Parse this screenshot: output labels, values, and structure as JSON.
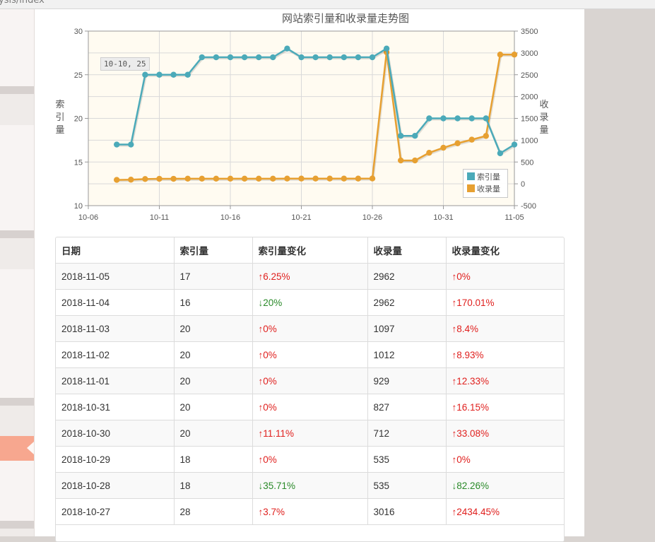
{
  "browser": {
    "url_fragment": "ysis/index"
  },
  "chart_data": {
    "type": "line",
    "title": "网站索引量和收录量走势图",
    "x_tick_labels": [
      "10-06",
      "10-11",
      "10-16",
      "10-21",
      "10-26",
      "10-31",
      "11-05"
    ],
    "x_range": [
      "2018-10-06",
      "2018-11-05"
    ],
    "left_axis": {
      "label": "索引量",
      "range": [
        10,
        30
      ],
      "ticks": [
        10,
        15,
        20,
        25,
        30
      ]
    },
    "right_axis": {
      "label": "收录量",
      "range": [
        -500,
        3500
      ],
      "ticks": [
        -500,
        0,
        500,
        1000,
        1500,
        2000,
        2500,
        3000,
        3500
      ]
    },
    "grid": true,
    "legend_position": "bottom-right",
    "tooltip": "10-10, 25",
    "series": [
      {
        "name": "索引量",
        "axis": "left",
        "color": "#4baab9",
        "x": [
          "2018-10-08",
          "2018-10-09",
          "2018-10-10",
          "2018-10-11",
          "2018-10-12",
          "2018-10-13",
          "2018-10-14",
          "2018-10-15",
          "2018-10-16",
          "2018-10-17",
          "2018-10-18",
          "2018-10-19",
          "2018-10-20",
          "2018-10-21",
          "2018-10-22",
          "2018-10-23",
          "2018-10-24",
          "2018-10-25",
          "2018-10-26",
          "2018-10-27",
          "2018-10-28",
          "2018-10-29",
          "2018-10-30",
          "2018-10-31",
          "2018-11-01",
          "2018-11-02",
          "2018-11-03",
          "2018-11-04",
          "2018-11-05"
        ],
        "values": [
          17,
          17,
          25,
          25,
          25,
          25,
          27,
          27,
          27,
          27,
          27,
          27,
          28,
          27,
          27,
          27,
          27,
          27,
          27,
          28,
          18,
          18,
          20,
          20,
          20,
          20,
          20,
          16,
          17
        ]
      },
      {
        "name": "收录量",
        "axis": "right",
        "color": "#e7a031",
        "x": [
          "2018-10-08",
          "2018-10-09",
          "2018-10-10",
          "2018-10-11",
          "2018-10-12",
          "2018-10-13",
          "2018-10-14",
          "2018-10-15",
          "2018-10-16",
          "2018-10-17",
          "2018-10-18",
          "2018-10-19",
          "2018-10-20",
          "2018-10-21",
          "2018-10-22",
          "2018-10-23",
          "2018-10-24",
          "2018-10-25",
          "2018-10-26",
          "2018-10-27",
          "2018-10-28",
          "2018-10-29",
          "2018-10-30",
          "2018-10-31",
          "2018-11-01",
          "2018-11-02",
          "2018-11-03",
          "2018-11-04",
          "2018-11-05"
        ],
        "values": [
          90,
          95,
          110,
          115,
          115,
          118,
          118,
          118,
          118,
          118,
          118,
          118,
          120,
          120,
          120,
          120,
          120,
          120,
          122,
          3016,
          535,
          535,
          712,
          827,
          929,
          1012,
          1097,
          2962,
          2962
        ]
      }
    ]
  },
  "table": {
    "headers": [
      "日期",
      "索引量",
      "索引量变化",
      "收录量",
      "收录量变化"
    ],
    "rows": [
      [
        "2018-11-05",
        "17",
        "↑6.25%",
        "2962",
        "↑0%"
      ],
      [
        "2018-11-04",
        "16",
        "↓20%",
        "2962",
        "↑170.01%"
      ],
      [
        "2018-11-03",
        "20",
        "↑0%",
        "1097",
        "↑8.4%"
      ],
      [
        "2018-11-02",
        "20",
        "↑0%",
        "1012",
        "↑8.93%"
      ],
      [
        "2018-11-01",
        "20",
        "↑0%",
        "929",
        "↑12.33%"
      ],
      [
        "2018-10-31",
        "20",
        "↑0%",
        "827",
        "↑16.15%"
      ],
      [
        "2018-10-30",
        "20",
        "↑11.11%",
        "712",
        "↑33.08%"
      ],
      [
        "2018-10-29",
        "18",
        "↑0%",
        "535",
        "↑0%"
      ],
      [
        "2018-10-28",
        "18",
        "↓35.71%",
        "535",
        "↓82.26%"
      ],
      [
        "2018-10-27",
        "28",
        "↑3.7%",
        "3016",
        "↑2434.45%"
      ]
    ]
  },
  "colors": {
    "up": "#e0201e",
    "down": "#2a8a29",
    "active_menu": "#f7a78f"
  }
}
